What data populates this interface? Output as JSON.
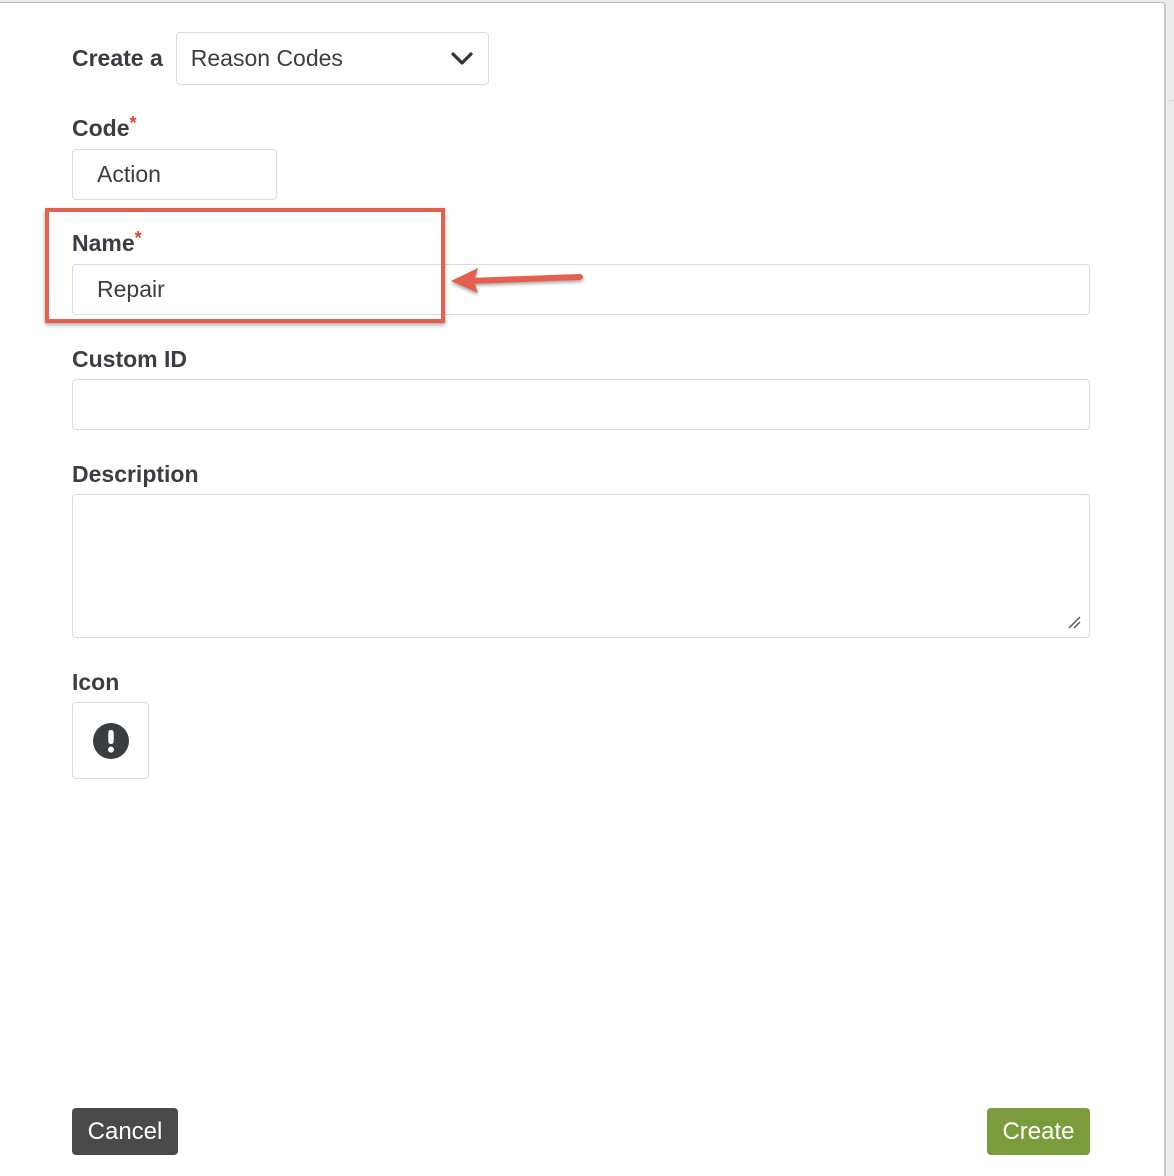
{
  "header": {
    "create_label": "Create a",
    "type_select": {
      "value": "Reason Codes",
      "icon": "chevron-down-icon"
    }
  },
  "fields": {
    "code": {
      "label": "Code",
      "required_mark": "*",
      "value": "Action"
    },
    "name": {
      "label": "Name",
      "required_mark": "*",
      "value": "Repair"
    },
    "custom_id": {
      "label": "Custom ID",
      "value": ""
    },
    "description": {
      "label": "Description",
      "value": ""
    },
    "icon": {
      "label": "Icon",
      "selected_icon": "exclamation-circle-icon"
    }
  },
  "annotation": {
    "highlight_color": "#e2604e",
    "arrow_color": "#e2604e"
  },
  "footer": {
    "cancel_label": "Cancel",
    "create_label": "Create",
    "cancel_color": "#4a4a4a",
    "create_color": "#7a9c3a"
  }
}
